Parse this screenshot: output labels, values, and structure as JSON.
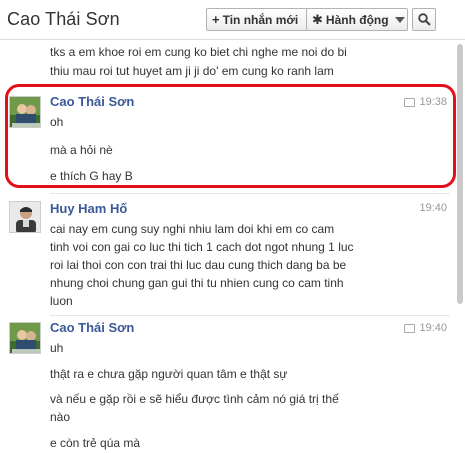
{
  "header": {
    "title": "Cao Thái Sơn",
    "new_message_label": "Tin nhắn mới",
    "actions_label": "Hành động",
    "icons": {
      "new": "plus-icon",
      "actions": "gear-icon",
      "search": "search-icon"
    }
  },
  "messages": [
    {
      "lines": [
        "tks a em khoe roi em cung ko biet chi nghe me noi do bi",
        "thiu mau roi tut huyet am ji ji do' em cung ko ranh lam"
      ]
    },
    {
      "sender": "Cao Thái Sơn",
      "time": "19:38",
      "lines": [
        "oh",
        "mà a hỏi nè",
        "e thích G hay B"
      ]
    },
    {
      "sender": "Huy Ham Hố",
      "time": "19:40",
      "lines": [
        "cai nay em cung suy nghi nhiu lam doi khi em co cam",
        "tinh voi con gai co luc thi tich 1 cach dot ngot nhung 1 luc",
        "roi lai thoi con con trai thi luc dau cung thich dang ba be",
        "nhung choi chung gan gui thi tu nhien cung co cam tinh",
        "luon"
      ]
    },
    {
      "sender": "Cao Thái Sơn",
      "time": "19:40",
      "lines": [
        "uh",
        "thật ra e chưa gặp người quan tâm e thật sự",
        "và nếu e gặp rồi e sẽ hiểu được tình cảm nó giá trị thế",
        "nào",
        "e còn trẻ qúa mà"
      ]
    }
  ],
  "colors": {
    "link": "#3b5998",
    "highlight": "#e3101a"
  }
}
